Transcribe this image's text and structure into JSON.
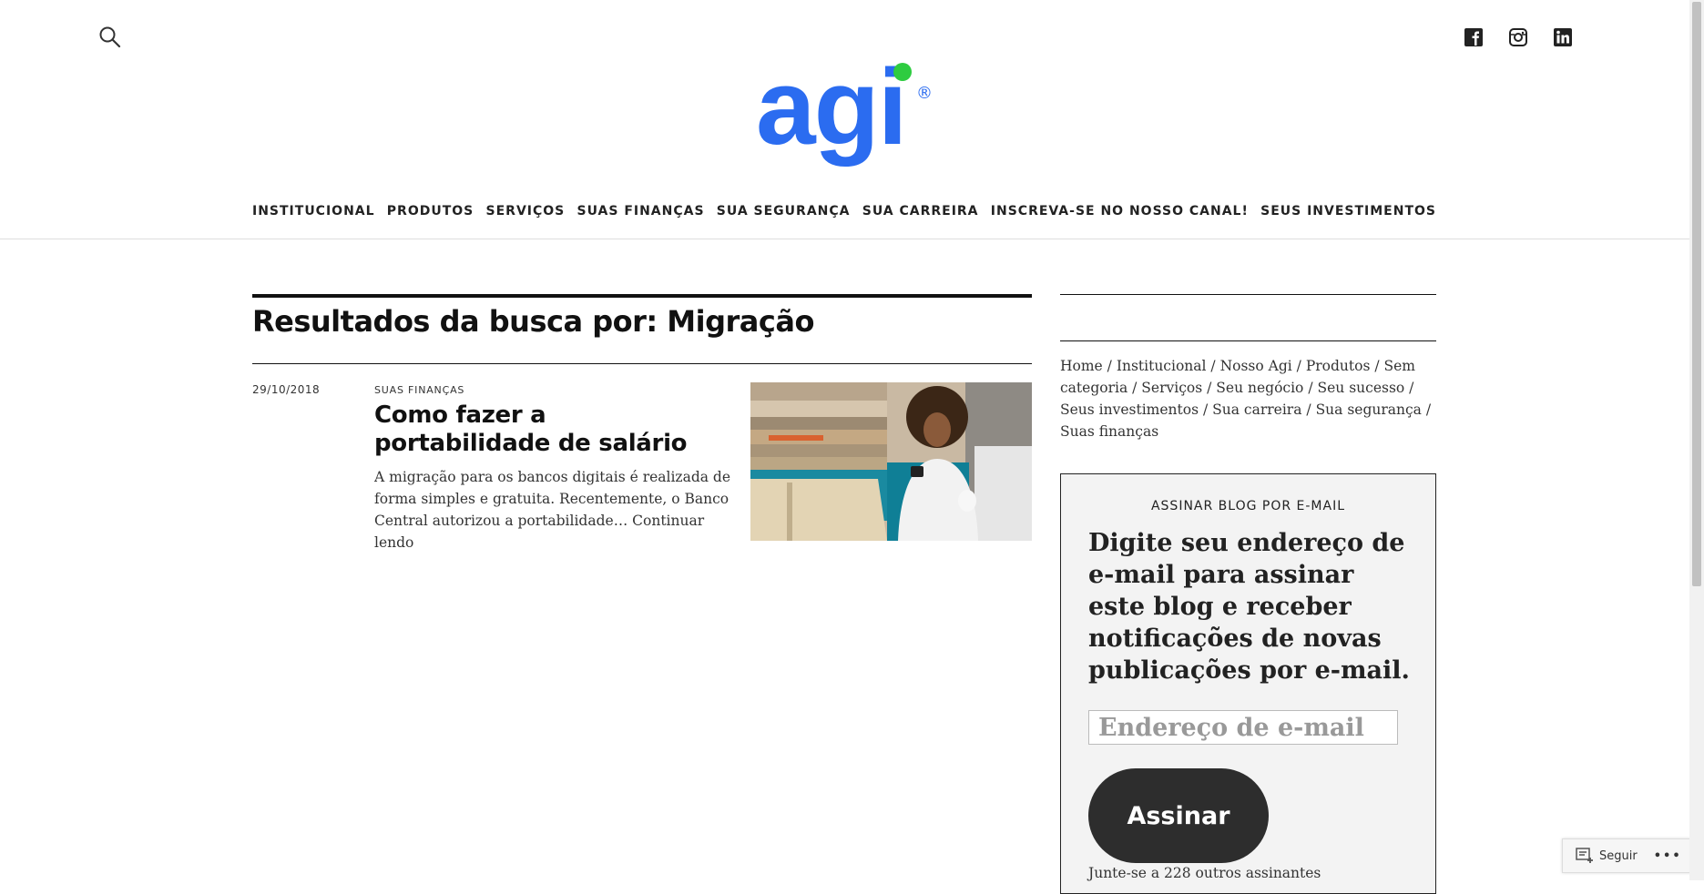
{
  "header": {
    "logo_text": "agi",
    "logo_mark": "®",
    "icons": [
      "search-icon",
      "facebook-icon",
      "instagram-icon",
      "linkedin-icon"
    ]
  },
  "nav": {
    "items": [
      "INSTITUCIONAL",
      "PRODUTOS",
      "SERVIÇOS",
      "SUAS FINANÇAS",
      "SUA SEGURANÇA",
      "SUA CARREIRA",
      "INSCREVA-SE NO NOSSO CANAL!",
      "SEUS INVESTIMENTOS"
    ]
  },
  "main": {
    "search_title": "Resultados da busca por: Migração",
    "post": {
      "date": "29/10/2018",
      "category": "SUAS FINANÇAS",
      "title": "Como fazer a portabilidade de salário",
      "excerpt": "A migração para os bancos digitais é realizada de forma simples e gratuita. Recentemente, o Banco Central autorizou a portabilidade…",
      "more_link": "Continuar lendo"
    }
  },
  "sidebar": {
    "categories": [
      "Home",
      "Institucional",
      "Nosso Agi",
      "Produtos",
      "Sem categoria",
      "Serviços",
      "Seu negócio",
      "Seu sucesso",
      "Seus investimentos",
      "Sua carreira",
      "Sua segurança",
      "Suas finanças"
    ],
    "separator": "/",
    "subscribe": {
      "heading": "ASSINAR BLOG POR E-MAIL",
      "text": "Digite seu endereço de e-mail para assinar este blog e receber notificações de novas publicações por e-mail.",
      "email_placeholder": "Endereço de e-mail",
      "button_label": "Assinar",
      "joined_text": "Junte-se a 228 outros assinantes"
    }
  },
  "follow_widget": {
    "label": "Seguir",
    "more": "•••"
  },
  "colors": {
    "brand_blue": "#2b6cf0",
    "brand_green": "#2ecc40",
    "button_dark": "#2d2d2d"
  }
}
